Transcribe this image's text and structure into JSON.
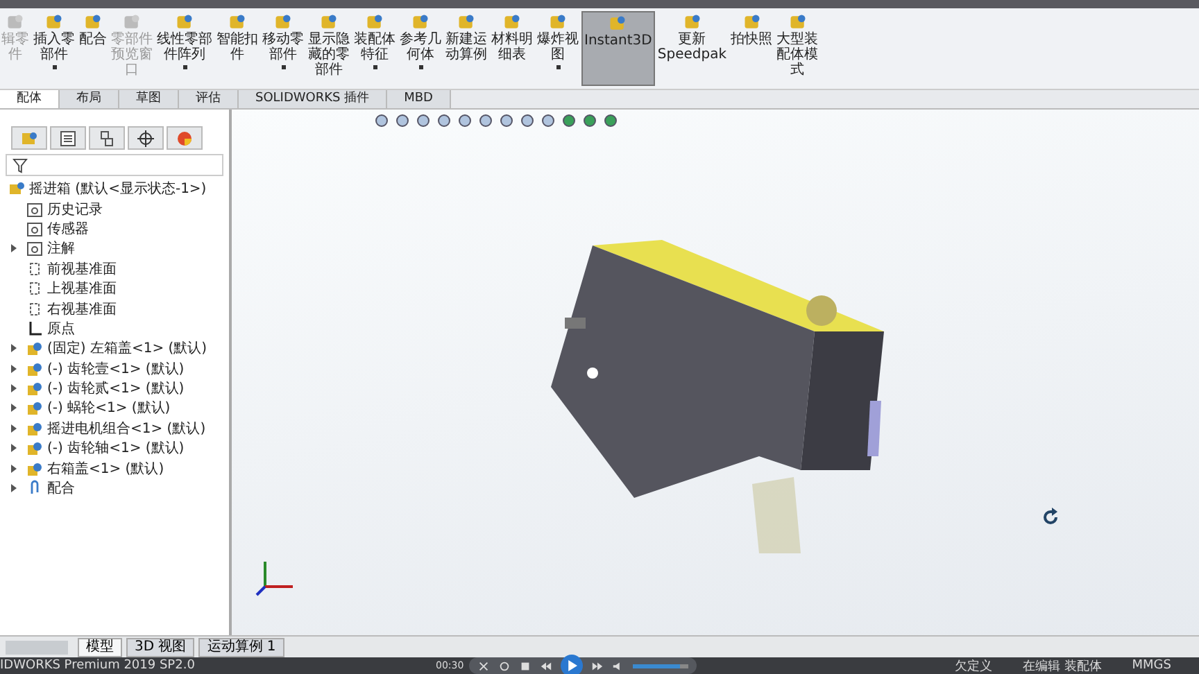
{
  "ribbon": [
    {
      "lines": [
        "辑零",
        "件"
      ],
      "dropdown": false,
      "disabled": true,
      "selected": false
    },
    {
      "lines": [
        "插入零",
        "部件"
      ],
      "dropdown": true,
      "disabled": false,
      "selected": false
    },
    {
      "lines": [
        "配合"
      ],
      "dropdown": false,
      "disabled": false,
      "selected": false
    },
    {
      "lines": [
        "零部件",
        "预览窗",
        "口"
      ],
      "dropdown": false,
      "disabled": true,
      "selected": false
    },
    {
      "lines": [
        "线性零部",
        "件阵列"
      ],
      "dropdown": true,
      "disabled": false,
      "selected": false
    },
    {
      "lines": [
        "智能扣",
        "件"
      ],
      "dropdown": false,
      "disabled": false,
      "selected": false
    },
    {
      "lines": [
        "移动零",
        "部件"
      ],
      "dropdown": true,
      "disabled": false,
      "selected": false
    },
    {
      "lines": [
        "显示隐",
        "藏的零",
        "部件"
      ],
      "dropdown": false,
      "disabled": false,
      "selected": false
    },
    {
      "lines": [
        "装配体",
        "特征"
      ],
      "dropdown": true,
      "disabled": false,
      "selected": false
    },
    {
      "lines": [
        "参考几",
        "何体"
      ],
      "dropdown": true,
      "disabled": false,
      "selected": false
    },
    {
      "lines": [
        "新建运",
        "动算例"
      ],
      "dropdown": false,
      "disabled": false,
      "selected": false
    },
    {
      "lines": [
        "材料明",
        "细表"
      ],
      "dropdown": false,
      "disabled": false,
      "selected": false
    },
    {
      "lines": [
        "爆炸视",
        "图"
      ],
      "dropdown": true,
      "disabled": false,
      "selected": false
    },
    {
      "lines": [
        "Instant3D"
      ],
      "dropdown": false,
      "disabled": false,
      "selected": true
    },
    {
      "lines": [
        "更新",
        "Speedpak"
      ],
      "dropdown": false,
      "disabled": false,
      "selected": false
    },
    {
      "lines": [
        "拍快照"
      ],
      "dropdown": false,
      "disabled": false,
      "selected": false
    },
    {
      "lines": [
        "大型装",
        "配体模",
        "式"
      ],
      "dropdown": false,
      "disabled": false,
      "selected": false
    }
  ],
  "tabs": [
    {
      "label": "配体",
      "selected": true
    },
    {
      "label": "布局",
      "selected": false
    },
    {
      "label": "草图",
      "selected": false
    },
    {
      "label": "评估",
      "selected": false
    },
    {
      "label": "SOLIDWORKS 插件",
      "selected": false
    },
    {
      "label": "MBD",
      "selected": false
    }
  ],
  "tree": {
    "label": "摇进箱 (默认<显示状态-1>)",
    "children": [
      {
        "kind": "history",
        "label": "历史记录",
        "expandable": false
      },
      {
        "kind": "sensor",
        "label": "传感器",
        "expandable": false
      },
      {
        "kind": "annotation",
        "label": "注解",
        "expandable": true
      },
      {
        "kind": "plane",
        "label": "前视基准面",
        "expandable": false
      },
      {
        "kind": "plane",
        "label": "上视基准面",
        "expandable": false
      },
      {
        "kind": "plane",
        "label": "右视基准面",
        "expandable": false
      },
      {
        "kind": "origin",
        "label": "原点",
        "expandable": false
      },
      {
        "kind": "component",
        "label": "(固定) 左箱盖<1> (默认)",
        "expandable": true
      },
      {
        "kind": "component",
        "label": "(-) 齿轮壹<1> (默认)",
        "expandable": true
      },
      {
        "kind": "component",
        "label": "(-) 齿轮贰<1> (默认)",
        "expandable": true
      },
      {
        "kind": "component",
        "label": "(-) 蜗轮<1> (默认)",
        "expandable": true
      },
      {
        "kind": "component",
        "label": "摇进电机组合<1> (默认)",
        "expandable": true
      },
      {
        "kind": "component",
        "label": "(-) 齿轮轴<1> (默认)",
        "expandable": true
      },
      {
        "kind": "component",
        "label": "右箱盖<1> (默认)",
        "expandable": true
      },
      {
        "kind": "mates",
        "label": "配合",
        "expandable": true
      }
    ]
  },
  "bottom_tabs": [
    {
      "label": "模型",
      "selected": true
    },
    {
      "label": "3D 视图",
      "selected": false
    },
    {
      "label": "运动算例 1",
      "selected": false
    }
  ],
  "status_bar": {
    "product": "IDWORKS Premium 2019 SP2.0",
    "time": "00:30",
    "volume": {
      "level": 0.85
    },
    "items": [
      "欠定义",
      "在编辑 装配体",
      "MMGS"
    ]
  }
}
